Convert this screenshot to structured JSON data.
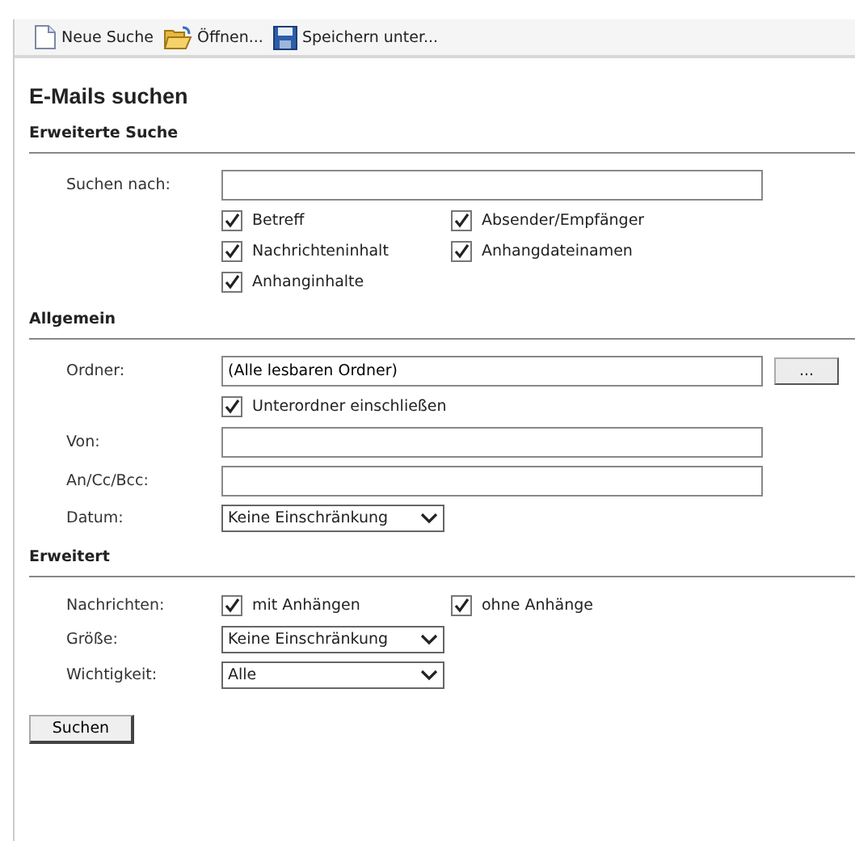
{
  "toolbar": [
    {
      "kind": "new",
      "label": "Neue Suche"
    },
    {
      "kind": "open",
      "label": "Öffnen..."
    },
    {
      "kind": "save",
      "label": "Speichern unter..."
    }
  ],
  "title": "E-Mails suchen",
  "sections": [
    {
      "heading": "Erweiterte Suche",
      "rows": [
        {
          "kind": "text",
          "label": "Suchen nach:"
        },
        {
          "kind": "checks",
          "items": [
            {
              "label": "Betreff",
              "checked": true
            },
            {
              "label": "Absender/Empfänger",
              "checked": true
            },
            {
              "label": "Nachrichteninhalt",
              "checked": true
            },
            {
              "label": "Anhangdateinamen",
              "checked": true
            },
            {
              "label": "Anhanginhalte",
              "checked": true
            }
          ]
        }
      ]
    },
    {
      "heading": "Allgemein",
      "rows": [
        {
          "kind": "browse",
          "label": "Ordner:",
          "value": "(Alle lesbaren Ordner)",
          "button": "..."
        },
        {
          "kind": "checks",
          "items": [
            {
              "label": "Unterordner einschließen",
              "checked": true
            }
          ]
        },
        {
          "kind": "text",
          "label": "Von:"
        },
        {
          "kind": "text",
          "label": "An/Cc/Bcc:"
        },
        {
          "kind": "select",
          "label": "Datum:",
          "value": "Keine Einschränkung"
        }
      ]
    },
    {
      "heading": "Erweitert",
      "rows": [
        {
          "kind": "checks",
          "label": "Nachrichten:",
          "items": [
            {
              "label": "mit Anhängen",
              "checked": true
            },
            {
              "label": "ohne Anhänge",
              "checked": true
            }
          ]
        },
        {
          "kind": "select",
          "label": "Größe:",
          "value": "Keine Einschränkung"
        },
        {
          "kind": "select",
          "label": "Wichtigkeit:",
          "value": "Alle"
        }
      ]
    }
  ],
  "submit": "Suchen"
}
